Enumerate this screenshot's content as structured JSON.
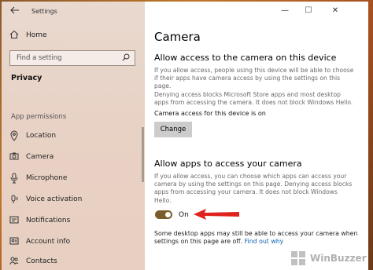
{
  "window": {
    "title": "Settings",
    "back_icon": "arrow-left-icon",
    "min_glyph": "—",
    "max_glyph": "☐",
    "close_glyph": "✕"
  },
  "sidebar": {
    "home_label": "Home",
    "search_placeholder": "Find a setting",
    "section_title": "Privacy",
    "group_label": "App permissions",
    "items": [
      {
        "label": "Location",
        "icon": "location-icon"
      },
      {
        "label": "Camera",
        "icon": "camera-icon"
      },
      {
        "label": "Microphone",
        "icon": "microphone-icon"
      },
      {
        "label": "Voice activation",
        "icon": "voice-icon"
      },
      {
        "label": "Notifications",
        "icon": "notification-icon"
      },
      {
        "label": "Account info",
        "icon": "account-icon"
      },
      {
        "label": "Contacts",
        "icon": "contacts-icon"
      }
    ]
  },
  "main": {
    "title": "Camera",
    "device_section": {
      "heading": "Allow access to the camera on this device",
      "description_lines": [
        "If you allow access, people using this device will be able to choose",
        "if their apps have camera access by using the settings on this page.",
        "Denying access blocks Microsoft Store apps and most desktop",
        "apps from accessing the camera. It does not block Windows Hello."
      ],
      "status": "Camera access for this device is on",
      "button_label": "Change"
    },
    "apps_section": {
      "heading": "Allow apps to access your camera",
      "description_lines": [
        "If you allow access, you can choose which apps can access your",
        "camera by using the settings on this page. Denying access blocks",
        "apps from accessing your camera. It does not block Windows Hello."
      ],
      "toggle_state": "On",
      "toggle_on": true,
      "note": "Some desktop apps may still be able to access your camera when settings on this page are off.",
      "link_label": "Find out why"
    }
  },
  "watermark": {
    "text": "WinBuzzer"
  },
  "colors": {
    "toggle_on": "#7a5d2b",
    "link": "#0a5fb0",
    "arrow": "#e0221e",
    "button_bg": "#cccccc"
  }
}
